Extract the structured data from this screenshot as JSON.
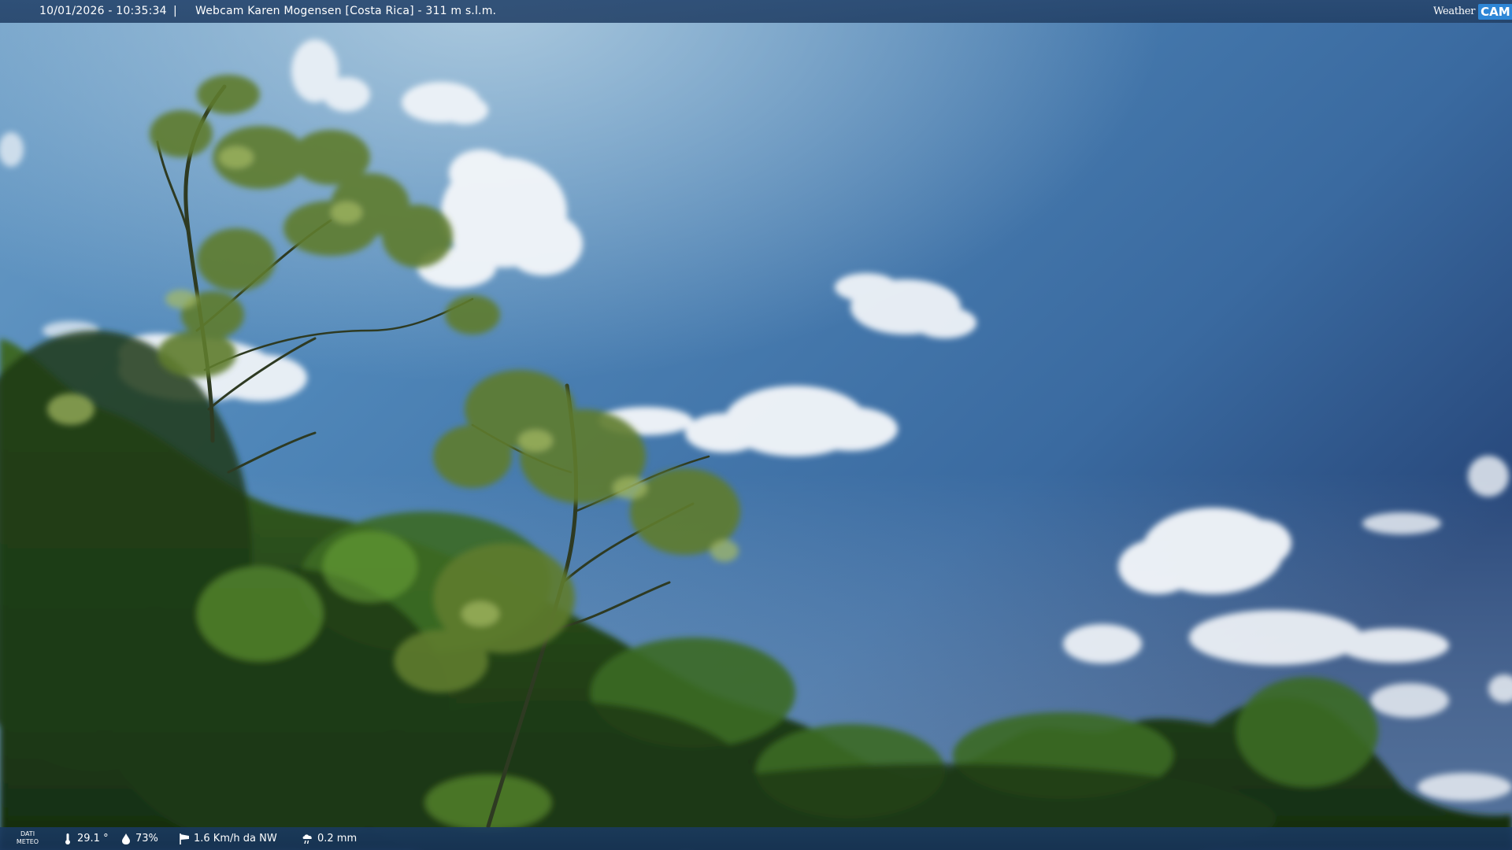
{
  "header": {
    "datetime": "10/01/2026 - 10:35:34",
    "separator": "|",
    "camera_title": "Webcam Karen Mogensen [Costa Rica] - 311 m s.l.m."
  },
  "logo": {
    "part_weather": "Weather",
    "part_cam": "CAM"
  },
  "footer": {
    "label_line1": "DATI",
    "label_line2": "METEO",
    "temperature": "29.1 °",
    "humidity": "73%",
    "wind": "1.6 Km/h da NW",
    "rain": "0.2 mm"
  },
  "icons": {
    "temperature": "thermometer-icon",
    "humidity": "droplet-icon",
    "wind": "windsock-icon",
    "rain": "rain-cloud-icon"
  },
  "scene": {
    "sky_top_color": "#4f86b8",
    "sky_right_color": "#27477a",
    "foliage_color": "#2f5a1f"
  }
}
